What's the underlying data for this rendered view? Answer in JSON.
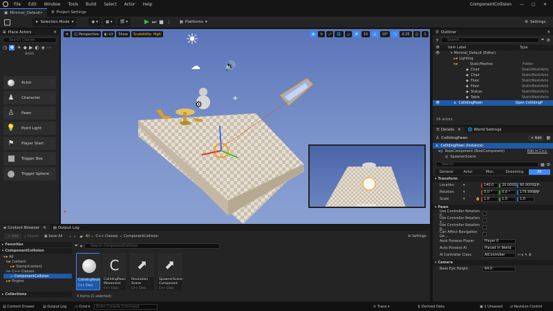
{
  "window": {
    "title": "ComponentCollision"
  },
  "menu": [
    "File",
    "Edit",
    "Window",
    "Tools",
    "Build",
    "Select",
    "Actor",
    "Help"
  ],
  "tabs": [
    {
      "label": "Minimal_Default•"
    },
    {
      "label": "Project Settings"
    }
  ],
  "toolbar": {
    "selection_mode": "Selection Mode",
    "platforms": "Platforms",
    "settings": "Settings"
  },
  "viewport": {
    "perspective": "Perspective",
    "lit": "Lit",
    "show": "Show",
    "scalability": "Scalability: High",
    "grid": "10",
    "angle": "10°",
    "scale": "0.25",
    "cam_speed": "1",
    "pip_value": "50.000000"
  },
  "place_actors": {
    "title": "Place Actors",
    "search": "Search Classes",
    "section": "BASIC",
    "items": [
      "Actor",
      "Character",
      "Pawn",
      "Point Light",
      "Player Start",
      "Trigger Box",
      "Trigger Sphere"
    ]
  },
  "outliner": {
    "title": "Outliner",
    "search": "Search...",
    "col_label": "Item Label",
    "col_type": "Type",
    "rows": [
      {
        "label": "Minimal_Default (Editor)",
        "type": ""
      },
      {
        "label": "Lighting",
        "type": ""
      },
      {
        "label": "StaticMeshes",
        "type": "Folder"
      },
      {
        "label": "Chair",
        "type": "StaticMeshActo"
      },
      {
        "label": "Chair",
        "type": "StaticMeshActo"
      },
      {
        "label": "Floor",
        "type": "StaticMeshActo"
      },
      {
        "label": "Floor",
        "type": "StaticMeshActo"
      },
      {
        "label": "Statue",
        "type": "StaticMeshActo"
      },
      {
        "label": "Table",
        "type": "StaticMeshActo"
      },
      {
        "label": "CollidingPawn",
        "type": "Open CollidingP"
      }
    ],
    "count": "16 actors"
  },
  "details": {
    "tab_details": "Details",
    "tab_world": "World Settings",
    "actor_name": "CollidingPawn",
    "add": "+ Add",
    "instance": "CollidingPawn (Instance)",
    "root": "RootComponent (RootComponent)",
    "edit_cpp": "Edit in C++",
    "spawner": "SpawnerScene",
    "search": "Search",
    "filters": [
      "General",
      "Actor",
      "Misc",
      "Streaming",
      "All"
    ],
    "transform": "Transform",
    "location": {
      "label": "Location",
      "x": "140.0",
      "y": "20.000031",
      "z": "80.000037"
    },
    "rotation": {
      "label": "Rotation",
      "x": "0.0 °",
      "y": "0.0 °",
      "z": "179.99999"
    },
    "scale": {
      "label": "Scale",
      "x": "1.0",
      "y": "1.0",
      "z": "1.0"
    },
    "pawn": "Pawn",
    "pawn_props": [
      "Use Controller Rotation P...",
      "Use Controller Rotation Y...",
      "Use Controller Rotation R...",
      "Can Affect Navigation Ge..."
    ],
    "auto_possess_player": {
      "label": "Auto Possess Player",
      "value": "Player 0"
    },
    "auto_possess_ai": {
      "label": "Auto Possess AI",
      "value": "Placed in World"
    },
    "ai_controller": {
      "label": "AI Controller Class",
      "value": "AIController"
    },
    "camera": "Camera",
    "base_eye": {
      "label": "Base Eye Height",
      "value": "64.0"
    }
  },
  "content_browser": {
    "tab": "Content Browser",
    "tab2": "Output Log",
    "add": "+ Add",
    "import": "Import",
    "save_all": "Save All",
    "path": [
      "All",
      "C++ Classes",
      "ComponentCollision"
    ],
    "settings": "Settings",
    "search": "Search ComponentCollision",
    "favorites": "Favorites",
    "project": "ComponentCollision",
    "tree": [
      "All",
      "Content",
      "StarterContent",
      "C++ Classes",
      "ComponentCollision",
      "Engine"
    ],
    "collections": "Collections",
    "assets": [
      {
        "name": "CollidingPawn",
        "type": "C++ Class"
      },
      {
        "name": "CollidingPawn Movement",
        "type": "C++ Class"
      },
      {
        "name": "Revolution Scene",
        "type": "C++ Class"
      },
      {
        "name": "SpawnerScene Component",
        "type": "C++ Class"
      }
    ],
    "status": "4 items (1 selected)"
  },
  "statusbar": {
    "content_drawer": "Content Drawer",
    "output_log": "Output Log",
    "cmd": "Cmd",
    "console": "Enter Console Command",
    "trace": "Trace",
    "derived": "Derived Data",
    "unsaved": "1 Unsaved",
    "revision": "Revision Control"
  },
  "colors": {
    "accent": "#3d8bff",
    "selection": "#1f5aa8",
    "play": "#3fbf3f",
    "orange": "#f0a020"
  }
}
